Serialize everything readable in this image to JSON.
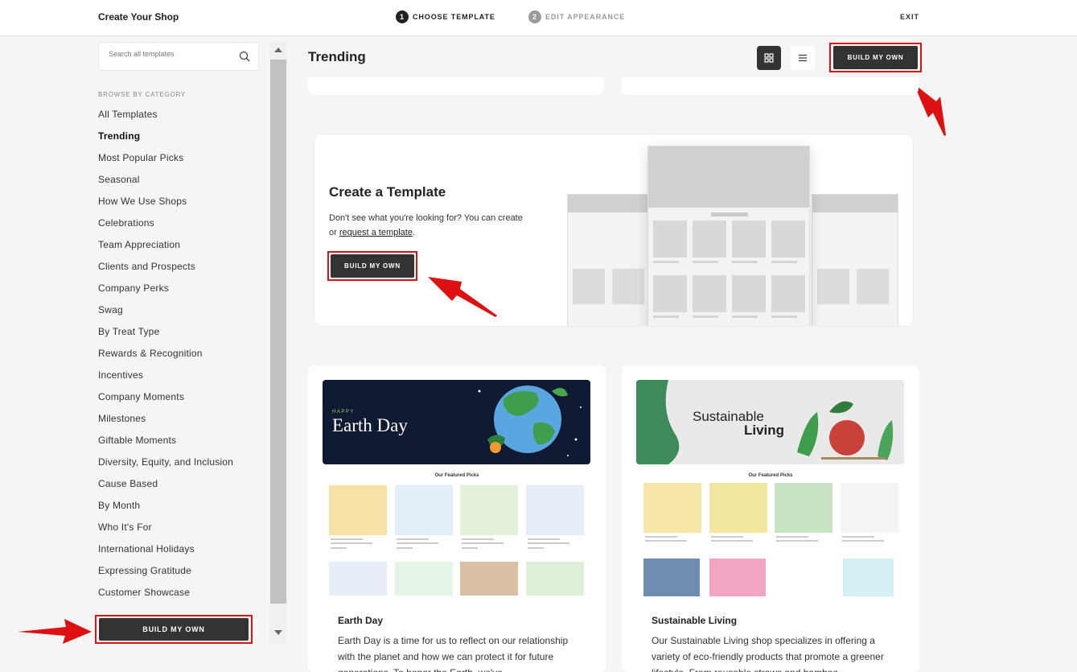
{
  "header": {
    "app_title": "Create Your Shop",
    "steps": [
      {
        "number": "1",
        "label": "CHOOSE TEMPLATE",
        "state": "active"
      },
      {
        "number": "2",
        "label": "EDIT APPEARANCE",
        "state": "inactive"
      }
    ],
    "exit_label": "EXIT"
  },
  "sidebar": {
    "search_placeholder": "Search all templates",
    "browse_label": "BROWSE BY CATEGORY",
    "categories": [
      "All Templates",
      "Trending",
      "Most Popular Picks",
      "Seasonal",
      "How We Use Shops",
      "Celebrations",
      "Team Appreciation",
      "Clients and Prospects",
      "Company Perks",
      "Swag",
      "By Treat Type",
      "Rewards & Recognition",
      "Incentives",
      "Company Moments",
      "Milestones",
      "Giftable Moments",
      "Diversity, Equity, and Inclusion",
      "Cause Based",
      "By Month",
      "Who It's For",
      "International Holidays",
      "Expressing Gratitude",
      "Customer Showcase"
    ],
    "active_category": "Trending",
    "build_label": "BUILD MY OWN"
  },
  "main": {
    "title": "Trending",
    "build_label": "BUILD MY OWN",
    "create_card": {
      "title": "Create a Template",
      "desc_prefix": "Don't see what you're looking for? You can create or ",
      "link_text": "request a template",
      "desc_suffix": ".",
      "build_label": "BUILD MY OWN"
    },
    "templates": [
      {
        "banner_small": "HAPPY",
        "banner_big": "Earth Day",
        "featured": "Our Featured Picks",
        "title": "Earth Day",
        "desc": "Earth Day is a time for us to reflect on our relationship with the planet and how we can protect it for future generations. To honor the Earth, we've"
      },
      {
        "banner_line1": "Sustainable",
        "banner_line2": "Living",
        "featured": "Our Featured Picks",
        "title": "Sustainable Living",
        "desc": "Our Sustainable Living shop specializes in offering a variety of eco-friendly products that promote a greener lifestyle. From reusable straws and bamboo"
      }
    ]
  },
  "colors": {
    "accent_dark": "#333333",
    "annotation_red": "#d11111",
    "earth_banner": "#111a33",
    "sustainable_banner": "#e9e9e9"
  }
}
